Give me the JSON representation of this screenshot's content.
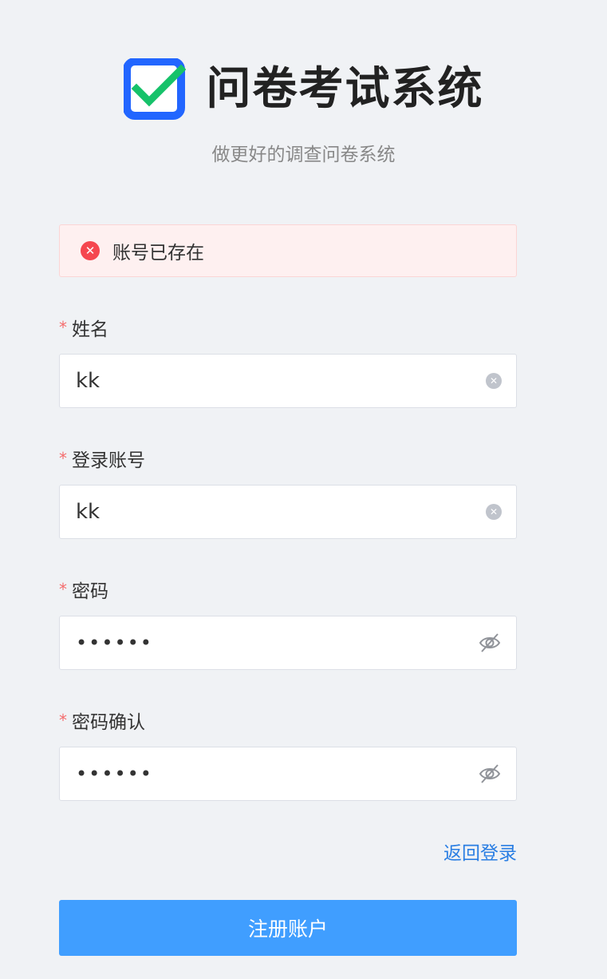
{
  "header": {
    "title": "问卷考试系统",
    "subtitle": "做更好的调查问卷系统",
    "logo_icon": "checkbox-checked-icon"
  },
  "alert": {
    "icon": "error-circle-icon",
    "message": "账号已存在"
  },
  "fields": [
    {
      "label": "姓名",
      "required": true,
      "value": "kk",
      "icon": "clear-icon"
    },
    {
      "label": "登录账号",
      "required": true,
      "value": "kk",
      "icon": "clear-icon"
    },
    {
      "label": "密码",
      "required": true,
      "value": "••••••",
      "icon": "eye-hidden-icon"
    },
    {
      "label": "密码确认",
      "required": true,
      "value": "••••••",
      "icon": "eye-hidden-icon"
    }
  ],
  "required_mark": "*",
  "back_link": "返回登录",
  "submit_label": "注册账户",
  "colors": {
    "primary": "#409eff",
    "link": "#2a7ee3",
    "error": "#f5474f",
    "logo_blue": "#2266ff",
    "logo_check": "#16c26a"
  }
}
